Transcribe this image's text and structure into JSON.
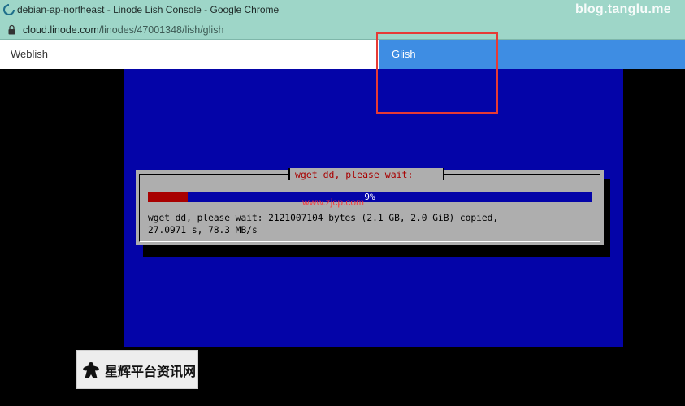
{
  "browser": {
    "title": "debian-ap-northeast - Linode Lish Console - Google Chrome",
    "url_host": "cloud.linode.com",
    "url_path": "/linodes/47001348/lish/glish",
    "watermark": "blog.tanglu.me"
  },
  "tabs": [
    {
      "label": "Weblish",
      "active": false
    },
    {
      "label": "Glish",
      "active": true
    }
  ],
  "console": {
    "dialog_title": "wget dd, please wait:",
    "progress_percent": 9,
    "progress_label": "9%",
    "status_line1": "wget dd, please wait: 2121007104 bytes (2.1 GB, 2.0 GiB) copied,",
    "status_line2": "27.0971 s, 78.3 MB/s",
    "watermark": "www.zjcp.com"
  },
  "badge": {
    "text": "星辉平台资讯网",
    "icon": "meeple-icon"
  },
  "colors": {
    "console_bg": "#0404a8",
    "dialog_bg": "#aeaeae",
    "progress_fill": "#a80000",
    "glish_tab": "#3e8de3",
    "highlight": "#e63a35",
    "chrome_bar": "#9ed6c8"
  }
}
